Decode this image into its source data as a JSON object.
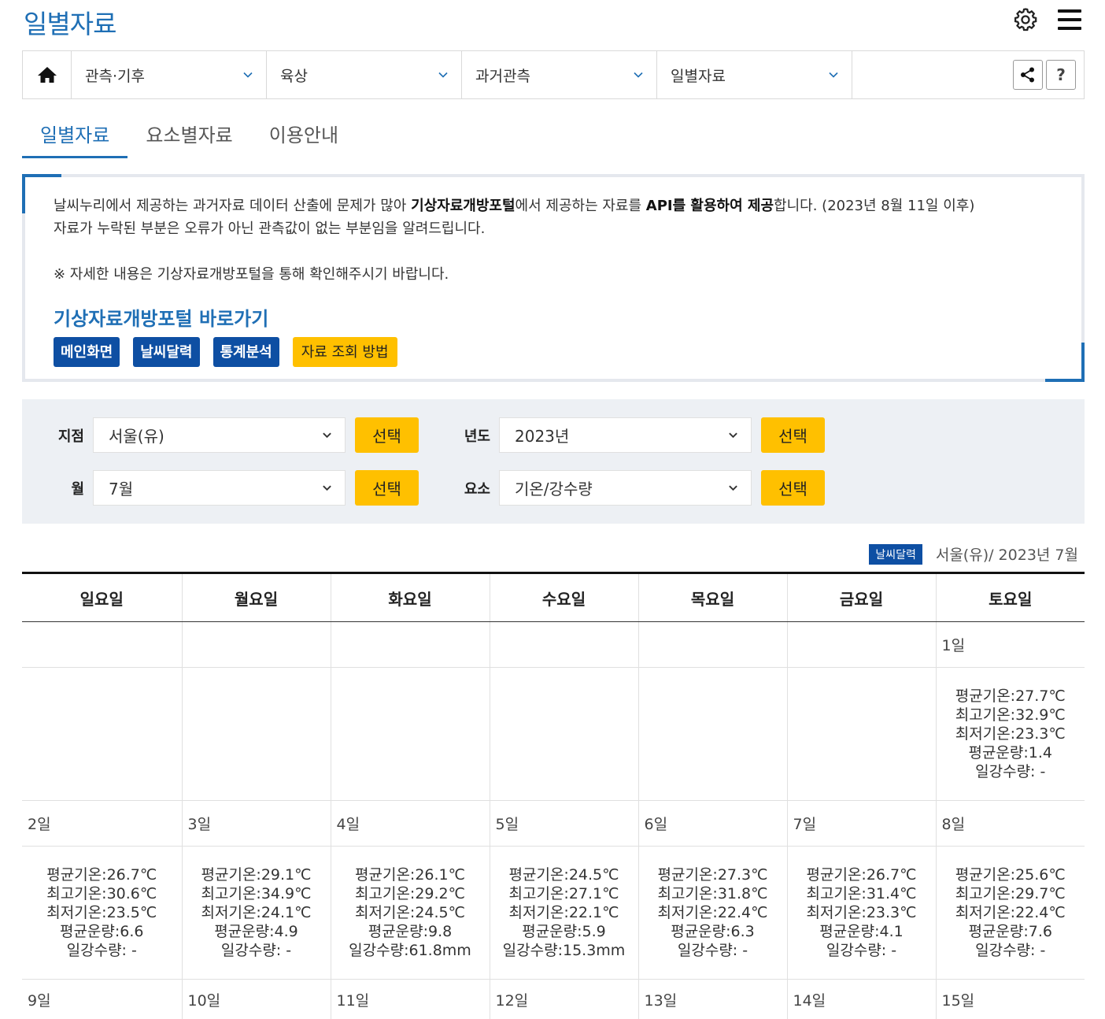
{
  "page_title": "일별자료",
  "nav": {
    "dropdowns": [
      "관측·기후",
      "육상",
      "과거관측",
      "일별자료"
    ],
    "help_label": "?"
  },
  "tabs": [
    "일별자료",
    "요소별자료",
    "이용안내"
  ],
  "notice": {
    "line1_a": "날씨누리에서 제공하는 과거자료 데이터 산출에 문제가 많아 ",
    "line1_b": "기상자료개방포털",
    "line1_c": "에서 제공하는 자료를 ",
    "line1_d": "API를 활용하여 제공",
    "line1_e": "합니다. (2023년 8월 11일 이후)",
    "line2": "자료가 누락된 부분은 오류가 아닌 관측값이 없는 부분임을 알려드립니다.",
    "line3": "※ 자세한 내용은 기상자료개방포털을 통해 확인해주시기 바랍니다.",
    "link_title": "기상자료개방포털 바로가기",
    "buttons": [
      "메인화면",
      "날씨달력",
      "통계분석"
    ],
    "guide_button": "자료 조회 방법"
  },
  "search": {
    "station_label": "지점",
    "station_value": "서울(유)",
    "year_label": "년도",
    "year_value": "2023년",
    "month_label": "월",
    "month_value": "7월",
    "element_label": "요소",
    "element_value": "기온/강수량",
    "select_label": "선택"
  },
  "calendar": {
    "badge": "날씨달력",
    "caption": "서울(유)/ 2023년 7월",
    "weekdays": [
      "일요일",
      "월요일",
      "화요일",
      "수요일",
      "목요일",
      "금요일",
      "토요일"
    ],
    "weeks": [
      {
        "dates": [
          "",
          "",
          "",
          "",
          "",
          "",
          "1일"
        ],
        "data": [
          null,
          null,
          null,
          null,
          null,
          null,
          [
            "평균기온:27.7℃",
            "최고기온:32.9℃",
            "최저기온:23.3℃",
            "평균운량:1.4",
            "일강수량: -"
          ]
        ]
      },
      {
        "dates": [
          "2일",
          "3일",
          "4일",
          "5일",
          "6일",
          "7일",
          "8일"
        ],
        "data": [
          [
            "평균기온:26.7℃",
            "최고기온:30.6℃",
            "최저기온:23.5℃",
            "평균운량:6.6",
            "일강수량: -"
          ],
          [
            "평균기온:29.1℃",
            "최고기온:34.9℃",
            "최저기온:24.1℃",
            "평균운량:4.9",
            "일강수량: -"
          ],
          [
            "평균기온:26.1℃",
            "최고기온:29.2℃",
            "최저기온:24.5℃",
            "평균운량:9.8",
            "일강수량:61.8mm"
          ],
          [
            "평균기온:24.5℃",
            "최고기온:27.1℃",
            "최저기온:22.1℃",
            "평균운량:5.9",
            "일강수량:15.3mm"
          ],
          [
            "평균기온:27.3℃",
            "최고기온:31.8℃",
            "최저기온:22.4℃",
            "평균운량:6.3",
            "일강수량: -"
          ],
          [
            "평균기온:26.7℃",
            "최고기온:31.4℃",
            "최저기온:23.3℃",
            "평균운량:4.1",
            "일강수량: -"
          ],
          [
            "평균기온:25.6℃",
            "최고기온:29.7℃",
            "최저기온:22.4℃",
            "평균운량:7.6",
            "일강수량: -"
          ]
        ]
      },
      {
        "dates": [
          "9일",
          "10일",
          "11일",
          "12일",
          "13일",
          "14일",
          "15일"
        ],
        "data": null
      }
    ]
  }
}
